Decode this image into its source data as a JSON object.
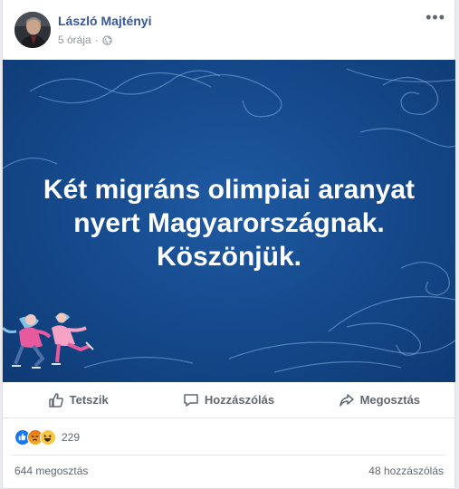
{
  "post": {
    "author": "László Majtényi",
    "timestamp": "5 órája",
    "separator": "·",
    "privacy_icon": "globe-icon",
    "more_icon": "more-options-icon",
    "image": {
      "text_lines": [
        "Két migráns olimpiai aranyat",
        "nyert Magyarországnak.",
        "Köszönjük."
      ]
    }
  },
  "actions": {
    "like": "Tetszik",
    "comment": "Hozzászólás",
    "share": "Megosztás"
  },
  "stats": {
    "reaction_count": "229",
    "reaction_icons": [
      "like-reaction-icon",
      "angry-reaction-icon",
      "haha-reaction-icon"
    ],
    "shares": "644 megosztás",
    "comments": "48 hozzászólás"
  },
  "colors": {
    "author": "#365899",
    "image_bg": "#164b8e",
    "like_blue": "#1877f2"
  }
}
